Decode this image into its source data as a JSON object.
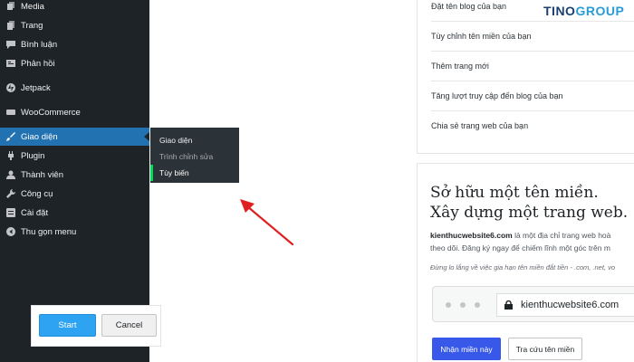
{
  "sidebar": {
    "items": [
      {
        "label": "Media",
        "icon": "media-icon"
      },
      {
        "label": "Trang",
        "icon": "pages-icon"
      },
      {
        "label": "Bình luận",
        "icon": "comments-icon"
      },
      {
        "label": "Phản hồi",
        "icon": "feedback-icon"
      },
      {
        "label": "Jetpack",
        "icon": "jetpack-icon"
      },
      {
        "label": "WooCommerce",
        "icon": "woocommerce-icon"
      },
      {
        "label": "Giao diện",
        "icon": "brush-icon",
        "active": true
      },
      {
        "label": "Plugin",
        "icon": "plugin-icon"
      },
      {
        "label": "Thành viên",
        "icon": "users-icon"
      },
      {
        "label": "Công cụ",
        "icon": "wrench-icon"
      },
      {
        "label": "Cài đặt",
        "icon": "settings-icon"
      },
      {
        "label": "Thu gọn menu",
        "icon": "collapse-icon"
      }
    ],
    "flyout": [
      "Giao diện",
      "Trình chỉnh sửa",
      "Tùy biến"
    ]
  },
  "tour": {
    "start_label": "Start",
    "cancel_label": "Cancel"
  },
  "logo": {
    "part1": "TINO",
    "part2": "GROUP"
  },
  "checklist": [
    "Đặt tên blog của bạn",
    "Tùy chỉnh tên miền của bạn",
    "Thêm trang mới",
    "Tăng lượt truy cập đến blog của bạn",
    "Chia sẻ trang web của bạn"
  ],
  "domain_card": {
    "heading_line1": "Sở hữu một tên miền.",
    "heading_line2": "Xây dựng một trang web.",
    "desc_domain": "kienthucwebsite6.com",
    "desc_rest1": " là một địa chỉ trang web hoà",
    "desc_line2": "theo dõi. Đăng ký ngay để chiếm lĩnh một góc trên m",
    "note": "Đừng lo lắng về việc gia hạn tên miền đắt tiền - .com, .net, vo",
    "url": "kienthucwebsite6.com",
    "claim_label": "Nhận miền này",
    "search_label": "Tra cứu tên miền"
  },
  "colors": {
    "sidebar_bg": "#1d2327",
    "active_item": "#2271b1",
    "flyout_bg": "#2c3338",
    "current_marker": "#00d95a",
    "start_button": "#2ea3f2",
    "claim_button": "#3858e9",
    "arrow": "#e02020",
    "logo_dark": "#1b3f73",
    "logo_light": "#2a9bd6"
  }
}
